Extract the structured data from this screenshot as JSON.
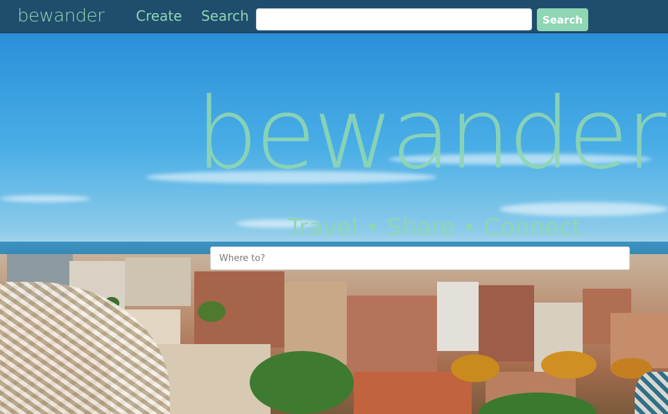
{
  "navbar": {
    "brand": "bewander",
    "links": [
      "Create",
      "Search"
    ],
    "search_placeholder": "",
    "search_button": "Search"
  },
  "hero": {
    "logo": "bewander",
    "tagline": "Travel • Share • Connect",
    "where_placeholder": "Where to?"
  },
  "colors": {
    "navbar_bg": "#1f4d6d",
    "accent": "#8fd6b3"
  }
}
